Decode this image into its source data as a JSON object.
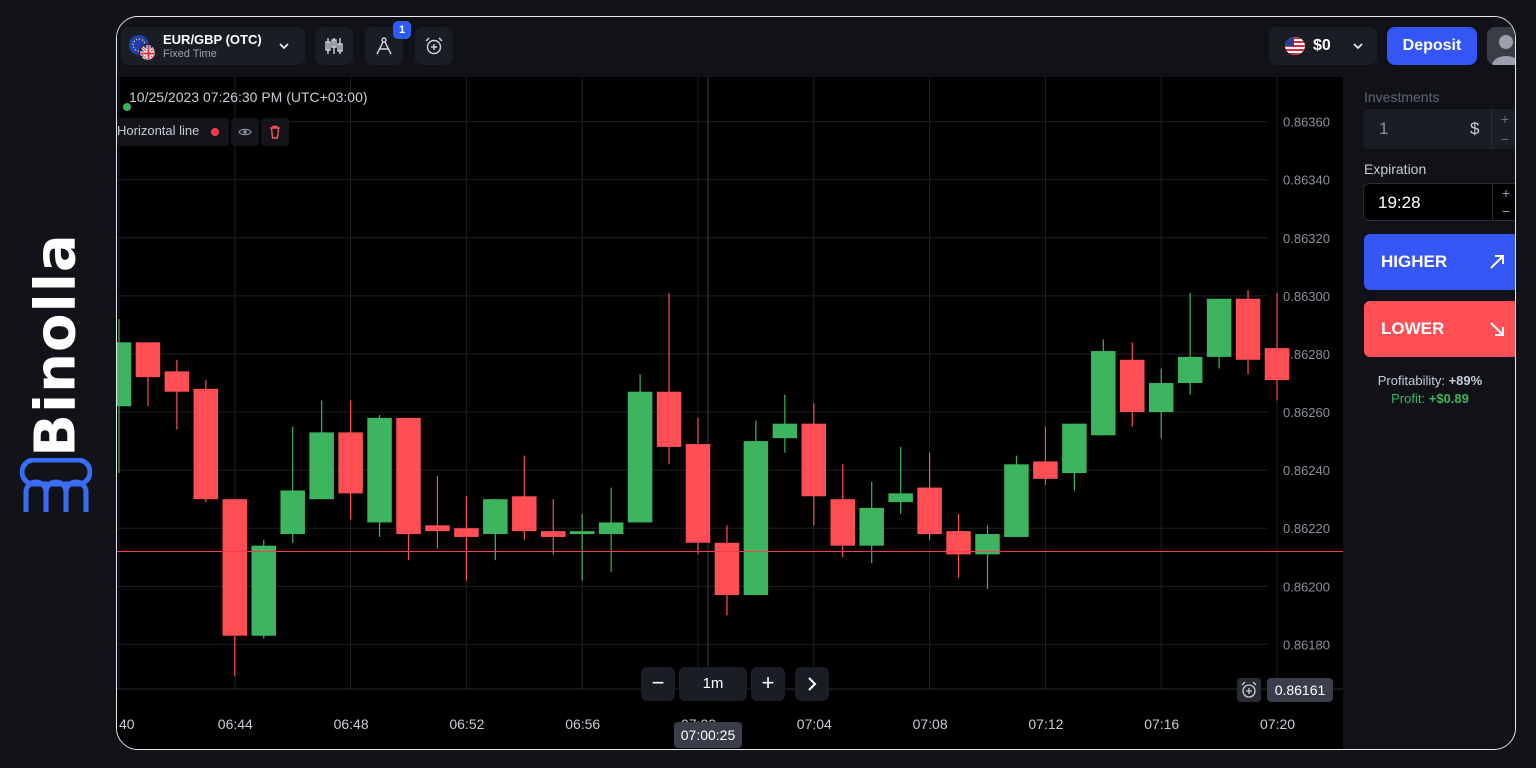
{
  "brand": {
    "name": "Binolla"
  },
  "header": {
    "asset_name": "EUR/GBP (OTC)",
    "asset_type": "Fixed Time",
    "drawings_badge": "1",
    "balance": "$0",
    "deposit_label": "Deposit"
  },
  "chart": {
    "timestamp": "10/25/2023  07:26:30 PM  (UTC+03:00)",
    "horizontal_line_label": "Horizontal line",
    "timeframe": "1m",
    "current_time": "07:00:25",
    "current_price": "0.86161",
    "colors": {
      "up": "#3cb55e",
      "down": "#ff4f55",
      "level_line": "#ff3b4d",
      "grid": "#1f2028"
    }
  },
  "panel": {
    "investments_label": "Investments",
    "investment_value": "1",
    "currency_symbol": "$",
    "expiration_label": "Expiration",
    "expiration_value": "19:28",
    "higher_label": "HIGHER",
    "lower_label": "LOWER",
    "profitability_label": "Profitability:",
    "profitability_value": "+89%",
    "profit_label": "Profit:",
    "profit_value": "+$0.89"
  },
  "chart_data": {
    "type": "candlestick",
    "x_tick_labels": [
      "40",
      "06:44",
      "06:48",
      "06:52",
      "06:56",
      "07:00",
      "07:04",
      "07:08",
      "07:12",
      "07:16",
      "07:20"
    ],
    "y_tick_labels": [
      "0.86360",
      "0.86340",
      "0.86320",
      "0.86300",
      "0.86280",
      "0.86260",
      "0.86240",
      "0.86220",
      "0.86200",
      "0.86180"
    ],
    "ylim": [
      0.86165,
      0.86375
    ],
    "horizontal_level": 0.86212,
    "candles": [
      {
        "o": 0.86262,
        "h": 0.86292,
        "l": 0.86239,
        "c": 0.86284
      },
      {
        "o": 0.86284,
        "h": 0.86284,
        "l": 0.86262,
        "c": 0.86272
      },
      {
        "o": 0.86274,
        "h": 0.86278,
        "l": 0.86254,
        "c": 0.86267
      },
      {
        "o": 0.86268,
        "h": 0.86271,
        "l": 0.86229,
        "c": 0.8623
      },
      {
        "o": 0.8623,
        "h": 0.8623,
        "l": 0.86169,
        "c": 0.86183
      },
      {
        "o": 0.86183,
        "h": 0.86216,
        "l": 0.86182,
        "c": 0.86214
      },
      {
        "o": 0.86218,
        "h": 0.86255,
        "l": 0.86215,
        "c": 0.86233
      },
      {
        "o": 0.8623,
        "h": 0.86264,
        "l": 0.8623,
        "c": 0.86253
      },
      {
        "o": 0.86253,
        "h": 0.86264,
        "l": 0.86223,
        "c": 0.86232
      },
      {
        "o": 0.86222,
        "h": 0.86259,
        "l": 0.86217,
        "c": 0.86258
      },
      {
        "o": 0.86258,
        "h": 0.86258,
        "l": 0.86209,
        "c": 0.86218
      },
      {
        "o": 0.86221,
        "h": 0.86238,
        "l": 0.86213,
        "c": 0.86219
      },
      {
        "o": 0.8622,
        "h": 0.86231,
        "l": 0.86202,
        "c": 0.86217
      },
      {
        "o": 0.86218,
        "h": 0.8623,
        "l": 0.86209,
        "c": 0.8623
      },
      {
        "o": 0.86231,
        "h": 0.86245,
        "l": 0.86216,
        "c": 0.86219
      },
      {
        "o": 0.86219,
        "h": 0.8623,
        "l": 0.86211,
        "c": 0.86217
      },
      {
        "o": 0.86218,
        "h": 0.86225,
        "l": 0.86202,
        "c": 0.86219
      },
      {
        "o": 0.86218,
        "h": 0.86234,
        "l": 0.86205,
        "c": 0.86222
      },
      {
        "o": 0.86222,
        "h": 0.86273,
        "l": 0.86222,
        "c": 0.86267
      },
      {
        "o": 0.86267,
        "h": 0.86301,
        "l": 0.86242,
        "c": 0.86248
      },
      {
        "o": 0.86249,
        "h": 0.86258,
        "l": 0.86211,
        "c": 0.86215
      },
      {
        "o": 0.86215,
        "h": 0.86221,
        "l": 0.8619,
        "c": 0.86197
      },
      {
        "o": 0.86197,
        "h": 0.86257,
        "l": 0.86197,
        "c": 0.8625
      },
      {
        "o": 0.86251,
        "h": 0.86266,
        "l": 0.86246,
        "c": 0.86256
      },
      {
        "o": 0.86256,
        "h": 0.86263,
        "l": 0.86221,
        "c": 0.86231
      },
      {
        "o": 0.8623,
        "h": 0.86242,
        "l": 0.8621,
        "c": 0.86214
      },
      {
        "o": 0.86214,
        "h": 0.86236,
        "l": 0.86208,
        "c": 0.86227
      },
      {
        "o": 0.86229,
        "h": 0.86248,
        "l": 0.86225,
        "c": 0.86232
      },
      {
        "o": 0.86234,
        "h": 0.86246,
        "l": 0.86216,
        "c": 0.86218
      },
      {
        "o": 0.86219,
        "h": 0.86225,
        "l": 0.86203,
        "c": 0.86211
      },
      {
        "o": 0.86211,
        "h": 0.86221,
        "l": 0.86199,
        "c": 0.86218
      },
      {
        "o": 0.86217,
        "h": 0.86245,
        "l": 0.86217,
        "c": 0.86242
      },
      {
        "o": 0.86243,
        "h": 0.86255,
        "l": 0.86235,
        "c": 0.86237
      },
      {
        "o": 0.86239,
        "h": 0.86256,
        "l": 0.86233,
        "c": 0.86256
      },
      {
        "o": 0.86252,
        "h": 0.86285,
        "l": 0.86252,
        "c": 0.86281
      },
      {
        "o": 0.86278,
        "h": 0.86284,
        "l": 0.86255,
        "c": 0.8626
      },
      {
        "o": 0.8626,
        "h": 0.86275,
        "l": 0.86251,
        "c": 0.8627
      },
      {
        "o": 0.8627,
        "h": 0.86301,
        "l": 0.86266,
        "c": 0.86279
      },
      {
        "o": 0.86279,
        "h": 0.86299,
        "l": 0.86275,
        "c": 0.86299
      },
      {
        "o": 0.86299,
        "h": 0.86302,
        "l": 0.86273,
        "c": 0.86278
      },
      {
        "o": 0.86282,
        "h": 0.86301,
        "l": 0.86264,
        "c": 0.86271
      }
    ]
  }
}
